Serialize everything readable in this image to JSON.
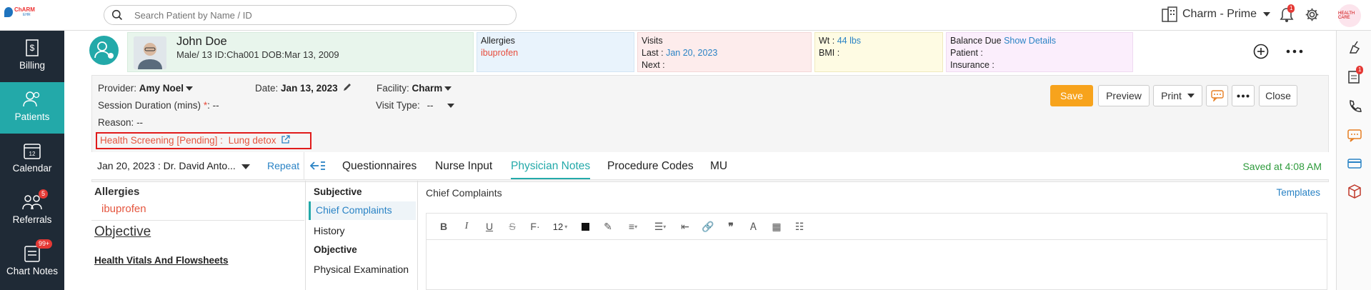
{
  "topbar": {
    "logo_text": "ChARM",
    "logo_sub": "EHR",
    "search_placeholder": "Search Patient by Name / ID",
    "clinic_name": "Charm - Prime",
    "notification_count": "1",
    "avatar_text": "HEALTH CARE"
  },
  "sidebar": {
    "items": [
      {
        "label": "Billing",
        "icon": "billing-icon"
      },
      {
        "label": "Patients",
        "icon": "patients-icon"
      },
      {
        "label": "Calendar",
        "icon": "calendar-icon"
      },
      {
        "label": "Referrals",
        "icon": "referrals-icon",
        "badge": "5"
      },
      {
        "label": "Chart Notes",
        "icon": "chart-notes-icon",
        "badge": "99+"
      }
    ]
  },
  "patient": {
    "name": "John Doe",
    "meta": "Male/ 13  ID:Cha001  DOB:Mar 13, 2009",
    "allergies_label": "Allergies",
    "allergies_value": "ibuprofen",
    "visits_label": "Visits",
    "last_label": "Last  :",
    "last_value": "Jan 20, 2023",
    "next_label": "Next :",
    "wt_label": "Wt   :",
    "wt_value": "44 lbs",
    "bmi_label": "BMI :",
    "balance_label": "Balance Due",
    "show_details": "Show Details",
    "patient_label": "Patient :",
    "insurance_label": "Insurance :"
  },
  "encounter": {
    "provider_label": "Provider:",
    "provider_value": "Amy Noel",
    "date_label": "Date:",
    "date_value": "Jan 13, 2023",
    "facility_label": "Facility:",
    "facility_value": "Charm",
    "session_label": "Session Duration (mins)",
    "session_required": "*",
    "session_value": ":  --",
    "visit_type_label": "Visit Type:",
    "visit_type_value": "--",
    "reason_label": "Reason:",
    "reason_value": "--",
    "health_screening": "Health Screening [Pending] :",
    "health_screening_link": "Lung detox"
  },
  "buttons": {
    "save": "Save",
    "preview": "Preview",
    "print": "Print",
    "close": "Close"
  },
  "tabs": {
    "encounter_select": "Jan 20, 2023 : Dr. David Anto...",
    "repeat": "Repeat",
    "items": [
      "Questionnaires",
      "Nurse Input",
      "Physician Notes",
      "Procedure Codes",
      "MU"
    ],
    "active": "Physician Notes",
    "saved_status": "Saved at 4:08 AM"
  },
  "left_panel": {
    "allergies_title": "Allergies",
    "allergies_item": "ibuprofen",
    "objective_title": "Objective",
    "vitals_title": "Health Vitals And Flowsheets"
  },
  "sections": {
    "subjective": "Subjective",
    "chief_complaints": "Chief Complaints",
    "history": "History",
    "objective": "Objective",
    "physical_examination": "Physical Examination"
  },
  "editor": {
    "title": "Chief Complaints",
    "templates": "Templates",
    "font_size": "12"
  },
  "colors": {
    "teal": "#23a9a9",
    "sidebar": "#1f2a36",
    "save": "#f7a31c",
    "alert_red": "#e01b1b"
  }
}
